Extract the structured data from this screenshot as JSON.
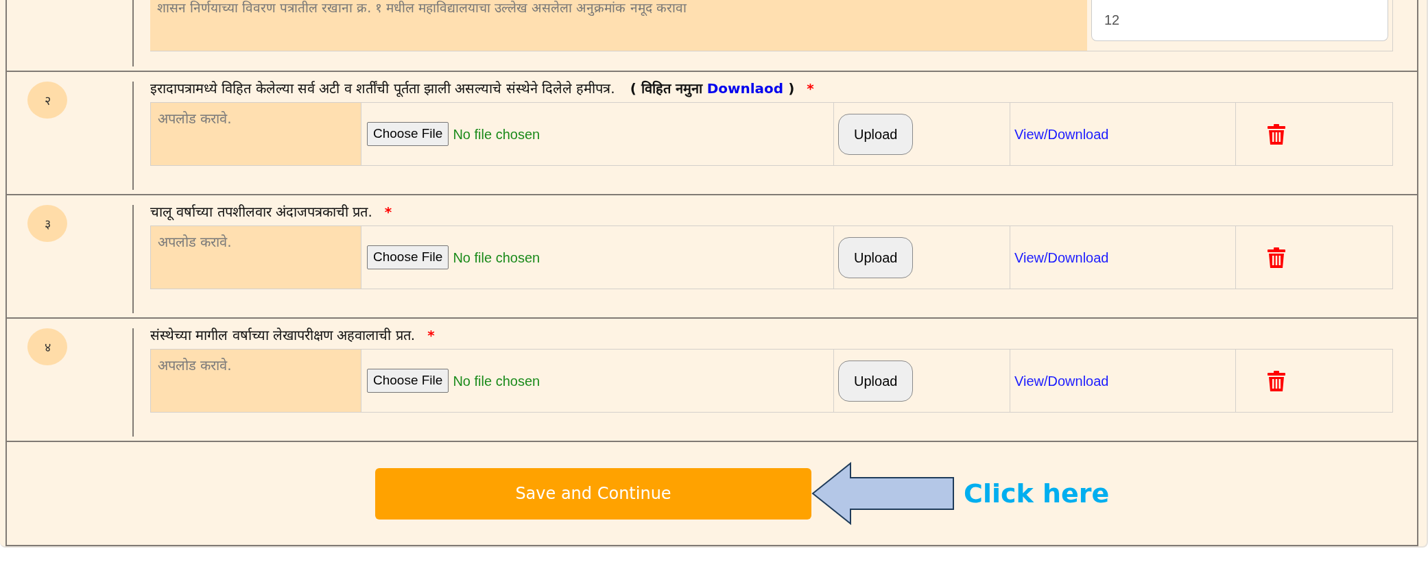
{
  "top_row": {
    "instruction": "शासन निर्णयाच्या विवरण पत्रातील रखाना क्र. १ मधील महाविद्यालयाचा उल्लेख असलेला अनुक्रमांक नमूद करावा",
    "value": "12"
  },
  "documents": [
    {
      "number": "२",
      "title": "इरादापत्रामध्ये विहित केलेल्या सर्व अटी व शर्तींची पूर्तता झाली असल्याचे संस्थेने दिलेले हमीपत्र.",
      "sample": {
        "prefix": "( विहित नमुना",
        "link": "Downlaod",
        "suffix": ")"
      },
      "required_mark": "*",
      "hint": "अपलोड करावे.",
      "choose_label": "Choose File",
      "file_status": "No file chosen",
      "upload_label": "Upload",
      "view_label": "View/Download"
    },
    {
      "number": "३",
      "title": "चालू वर्षाच्या तपशीलवार अंदाजपत्रकाची प्रत.",
      "required_mark": "*",
      "hint": "अपलोड करावे.",
      "choose_label": "Choose File",
      "file_status": "No file chosen",
      "upload_label": "Upload",
      "view_label": "View/Download"
    },
    {
      "number": "४",
      "title": "संस्थेच्या मागील वर्षाच्या लेखापरीक्षण अहवालाची प्रत.",
      "required_mark": "*",
      "hint": "अपलोड करावे.",
      "choose_label": "Choose File",
      "file_status": "No file chosen",
      "upload_label": "Upload",
      "view_label": "View/Download"
    }
  ],
  "save_button": "Save and Continue",
  "callout": "Click here"
}
